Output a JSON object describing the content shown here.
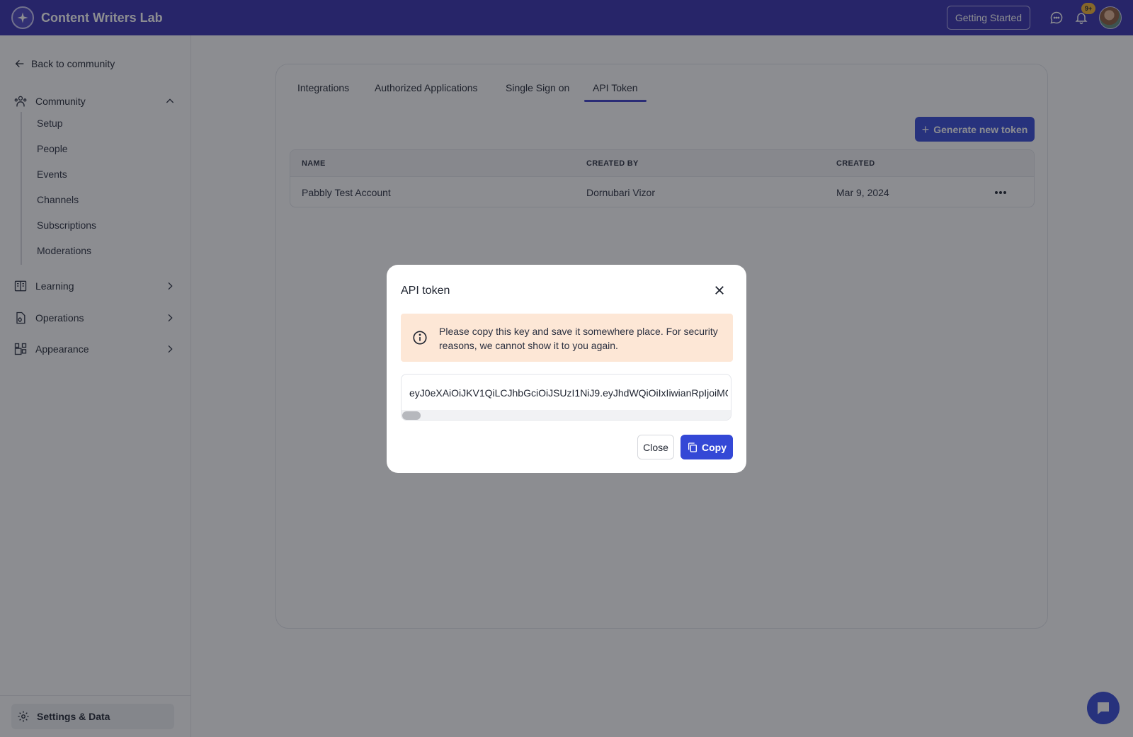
{
  "app": {
    "name": "Content Writers Lab",
    "getting_started": "Getting Started",
    "notification_badge": "9+"
  },
  "sidebar": {
    "back_label": "Back to community",
    "groups": [
      {
        "label": "Community",
        "icon": "community-icon",
        "expanded": true,
        "items": [
          "Setup",
          "People",
          "Events",
          "Channels",
          "Subscriptions",
          "Moderations"
        ]
      },
      {
        "label": "Learning",
        "icon": "book-icon",
        "expanded": false
      },
      {
        "label": "Operations",
        "icon": "document-icon",
        "expanded": false
      },
      {
        "label": "Appearance",
        "icon": "grid-icon",
        "expanded": false
      }
    ],
    "settings_label": "Settings & Data"
  },
  "main": {
    "tabs": [
      "Integrations",
      "Authorized Applications",
      "Single Sign on",
      "API Token"
    ],
    "active_tab": "API Token",
    "generate_button": "Generate new token",
    "table": {
      "headers": [
        "NAME",
        "CREATED BY",
        "CREATED"
      ],
      "rows": [
        {
          "name": "Pabbly Test Account",
          "created_by": "Dornubari Vizor",
          "created": "Mar 9, 2024"
        }
      ]
    }
  },
  "modal": {
    "title": "API token",
    "alert_text": "Please copy this key and save it somewhere place. For security reasons, we cannot show it to you again.",
    "token": "eyJ0eXAiOiJKV1QiLCJhbGciOiJSUzI1NiJ9.eyJhdWQiOiIxIiwianRpIjoiMG",
    "close_label": "Close",
    "copy_label": "Copy"
  },
  "colors": {
    "topbar": "#342eae",
    "primary": "#3448d6",
    "alert_bg": "#fde7d6",
    "badge": "#f2b230"
  }
}
